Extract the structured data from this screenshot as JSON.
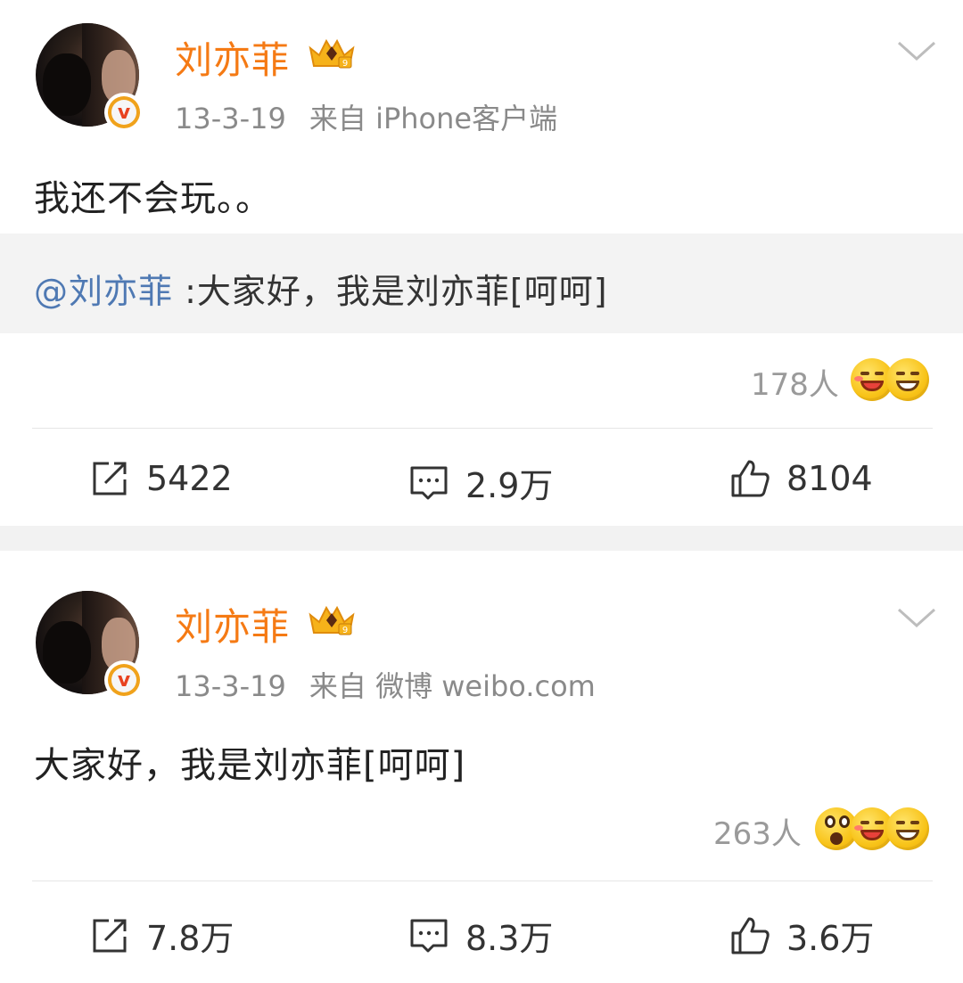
{
  "posts": [
    {
      "user": {
        "name": "刘亦菲",
        "verified_badge": "v"
      },
      "date": "13-3-19",
      "source": "来自 iPhone客户端",
      "text": "我还不会玩。。",
      "repost": {
        "mention": "@刘亦菲",
        "text": " :大家好，我是刘亦菲[呵呵]"
      },
      "reactions_count": "178人",
      "reaction_icons": [
        "laugh-blush-emoji-icon",
        "grin-emoji-icon"
      ],
      "actions": {
        "repost": "5422",
        "comment": "2.9万",
        "like": "8104"
      }
    },
    {
      "user": {
        "name": "刘亦菲",
        "verified_badge": "v"
      },
      "date": "13-3-19",
      "source": "来自 微博 weibo.com",
      "text": "大家好，我是刘亦菲[呵呵]",
      "reactions_count": "263人",
      "reaction_icons": [
        "shock-emoji-icon",
        "laugh-blush-emoji-icon",
        "grin-emoji-icon"
      ],
      "actions": {
        "repost": "7.8万",
        "comment": "8.3万",
        "like": "3.6万"
      }
    }
  ],
  "colors": {
    "name": "#f57a14",
    "meta": "#8a8a8a",
    "mention": "#4f79b3",
    "separator": "#f2f2f2"
  }
}
